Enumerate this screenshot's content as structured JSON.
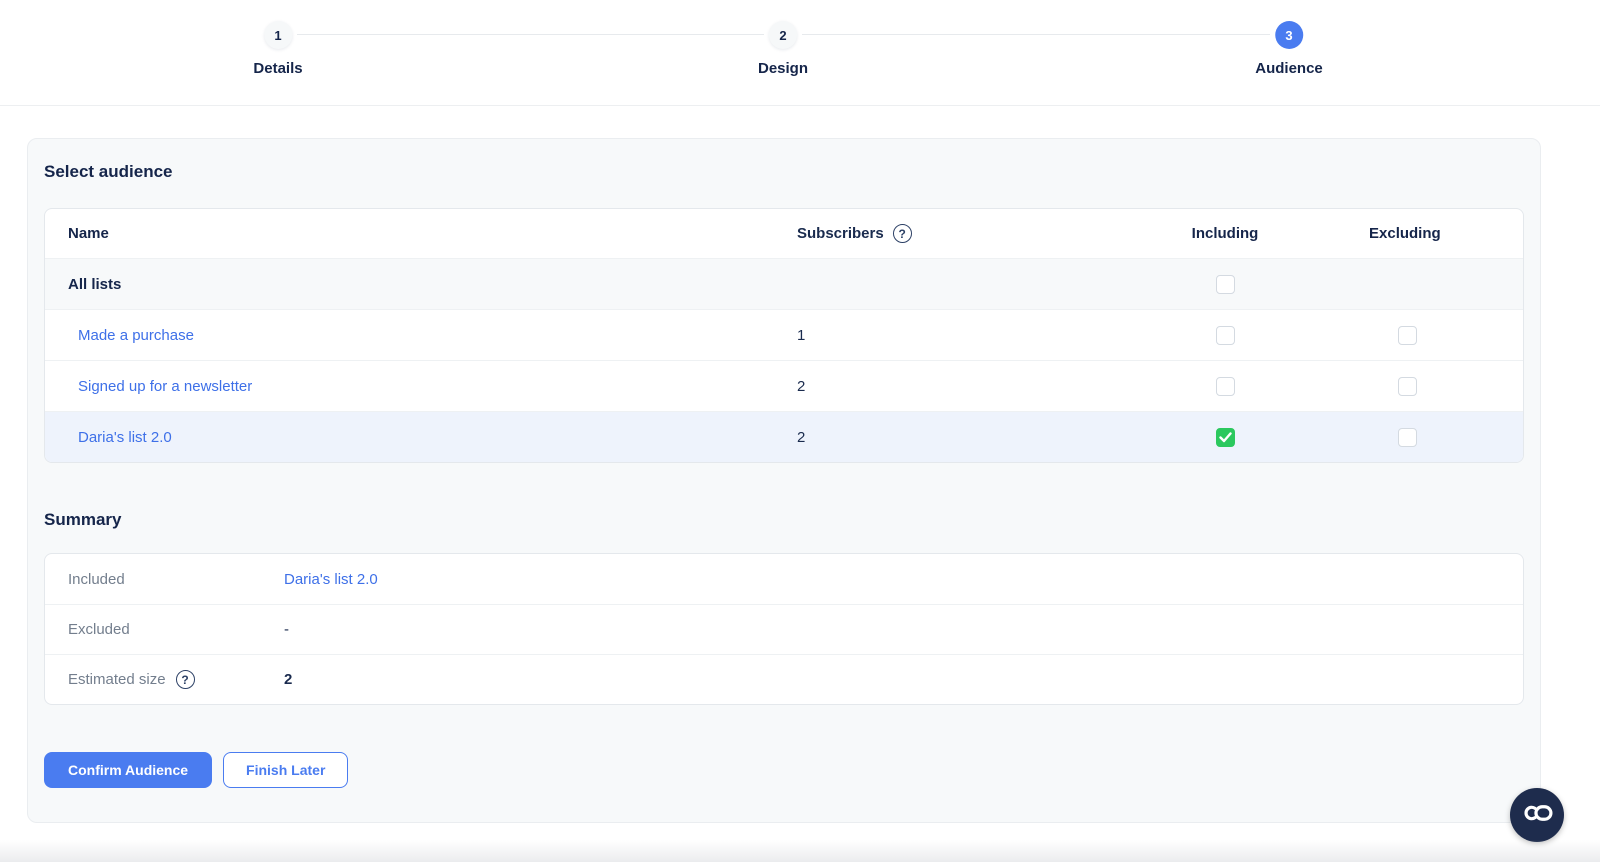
{
  "stepper": {
    "active_step": "3",
    "steps": [
      {
        "number": "1",
        "label": "Details"
      },
      {
        "number": "2",
        "label": "Design"
      },
      {
        "number": "3",
        "label": "Audience"
      }
    ]
  },
  "audience_section": {
    "title": "Select audience",
    "table": {
      "headers": {
        "name": "Name",
        "subscribers": "Subscribers",
        "including": "Including",
        "excluding": "Excluding"
      },
      "all_lists": {
        "label": "All lists",
        "including_checked": false
      },
      "rows": [
        {
          "name": "Made a purchase",
          "subscribers": "1",
          "including": false,
          "excluding": false,
          "selected": false
        },
        {
          "name": "Signed up for a newsletter",
          "subscribers": "2",
          "including": false,
          "excluding": false,
          "selected": false
        },
        {
          "name": "Daria's list 2.0",
          "subscribers": "2",
          "including": true,
          "excluding": false,
          "selected": true
        }
      ]
    }
  },
  "summary_section": {
    "title": "Summary",
    "included": {
      "label": "Included",
      "value": "Daria's list 2.0"
    },
    "excluded": {
      "label": "Excluded",
      "value": "-"
    },
    "estimated_size": {
      "label": "Estimated size",
      "value": "2"
    }
  },
  "actions": {
    "confirm": "Confirm Audience",
    "finish_later": "Finish Later"
  },
  "icons": {
    "help_glyph": "?"
  },
  "colors": {
    "accent": "#4a7cf0",
    "link": "#3e70e8",
    "checked_green": "#2bc85e",
    "heading": "#15254a",
    "selected_row_bg": "#eef3fc",
    "chat_fab_bg": "#1e2c4d"
  }
}
